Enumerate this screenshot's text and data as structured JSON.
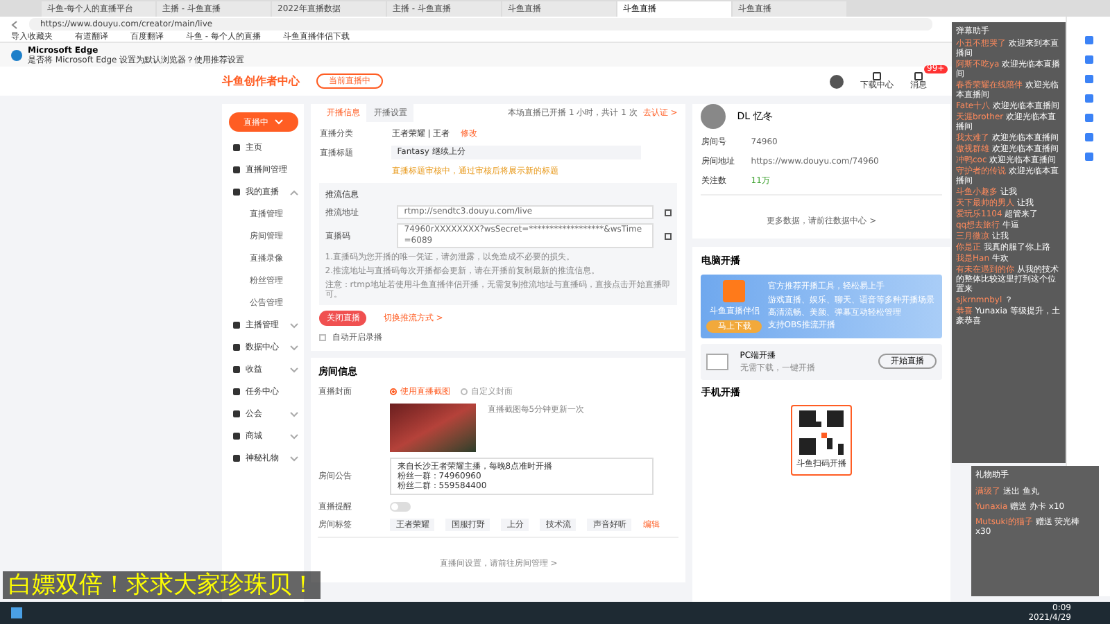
{
  "browser": {
    "tabs": [
      {
        "label": "斗鱼-每个人的直播平台",
        "selected": false
      },
      {
        "label": "主播 - 斗鱼直播",
        "selected": false
      },
      {
        "label": "2022年直播数据",
        "selected": false
      },
      {
        "label": "主播 - 斗鱼直播",
        "selected": false
      },
      {
        "label": "斗鱼直播",
        "selected": false
      },
      {
        "label": "斗鱼直播",
        "selected": true
      },
      {
        "label": "斗鱼直播",
        "selected": false
      }
    ],
    "url": "https://www.douyu.com/creator/main/live",
    "bookmarks": [
      "导入收藏夹",
      "有道翻译",
      "百度翻译",
      "斗鱼 - 每个人的直播",
      "斗鱼直播伴侣下载"
    ],
    "notification": {
      "title": "Microsoft Edge",
      "text": "是否将 Microsoft Edge 设置为默认浏览器？使用推荐设置"
    }
  },
  "site_header": {
    "logo": "斗鱼创作者中心",
    "badge": "当前直播中",
    "nav": [
      {
        "label": "下载中心"
      },
      {
        "label": "消息"
      }
    ],
    "message_count": "99+"
  },
  "sidebar": {
    "live_button": "直播中",
    "items": [
      {
        "label": "主页"
      },
      {
        "label": "直播间管理"
      },
      {
        "label": "我的直播",
        "expanded": true,
        "children": [
          {
            "label": "直播管理"
          },
          {
            "label": "房间管理"
          },
          {
            "label": "直播录像"
          },
          {
            "label": "粉丝管理"
          },
          {
            "label": "公告管理"
          }
        ]
      },
      {
        "label": "主播管理",
        "expanded": false
      },
      {
        "label": "数据中心",
        "expanded": false
      },
      {
        "label": "收益",
        "expanded": false
      },
      {
        "label": "任务中心"
      },
      {
        "label": "公会",
        "expanded": false
      },
      {
        "label": "商城",
        "expanded": false
      },
      {
        "label": "神秘礼物",
        "expanded": false
      }
    ]
  },
  "live_info": {
    "tabs": [
      {
        "label": "开播信息",
        "selected": true
      },
      {
        "label": "开播设置",
        "selected": false
      }
    ],
    "notice": "本场直播已开播 1 小时，共计 1 次",
    "notice_link": "去认证 >",
    "category": {
      "label": "直播分类",
      "value": "王者荣耀 | 王者",
      "action": "修改"
    },
    "title": {
      "label": "直播标题",
      "value": "Fantasy 继续上分"
    },
    "warning": "直播标题审核中，通过审核后将展示新的标题",
    "stream": {
      "heading": "推流信息",
      "fields": [
        {
          "label": "推流地址",
          "value": "rtmp://sendtc3.douyu.com/live"
        },
        {
          "label": "直播码",
          "value": "74960rXXXXXXXX?wsSecret=******************&wsTime=6089"
        }
      ],
      "notes": [
        "1.直播码为您开播的唯一凭证，请勿泄露，以免造成不必要的损失。",
        "2.推流地址与直播码每次开播都会更新，请在开播前复制最新的推流信息。",
        "注意：rtmp地址若使用斗鱼直播伴侣开播，无需复制推流地址与直播码，直接点击开始直播即可。"
      ]
    },
    "stop_button": "关闭直播",
    "switch_link": "切换推流方式 >",
    "auto_record": {
      "label": "自动开启录播",
      "checked": false
    }
  },
  "room_info": {
    "heading": "房间信息",
    "cover": {
      "label": "直播封面",
      "options": [
        {
          "label": "使用直播截图",
          "selected": true
        },
        {
          "label": "自定义封面",
          "selected": false
        }
      ],
      "hint": "直播截图每5分钟更新一次"
    },
    "announcement": {
      "label": "房间公告",
      "lines": [
        "来自长沙王者荣耀主播，每晚8点准时开播",
        "粉丝一群：74960960",
        "粉丝二群：559584400"
      ]
    },
    "toggle": {
      "label": "直播提醒",
      "on": false
    },
    "tags": {
      "label": "房间标签",
      "items": [
        "王者荣耀",
        "国服打野",
        "上分",
        "技术流",
        "声音好听"
      ],
      "edit": "编辑"
    },
    "footer_link": "直播间设置，请前往房间管理 >"
  },
  "profile": {
    "name": "DL 忆冬",
    "rows": [
      {
        "label": "房间号",
        "value": "74960"
      },
      {
        "label": "房间地址",
        "value": "https://www.douyu.com/74960"
      },
      {
        "label": "关注数",
        "value": "11万"
      }
    ],
    "footer_link": "更多数据，请前往数据中心 >"
  },
  "pc_live": {
    "heading": "电脑开播",
    "banner": {
      "title": "官方推荐开播工具，轻松易上手",
      "lines": [
        "游戏直播、娱乐、聊天、语音等多种开播场景",
        "高清流畅、美颜、弹幕互动轻松管理",
        "支持OBS推流开播"
      ],
      "app_name": "斗鱼直播伴侣",
      "download": "马上下载"
    },
    "pc": {
      "title": "PC端开播",
      "subtitle": "无需下载，一键开播",
      "button": "开始直播"
    }
  },
  "mobile": {
    "heading": "手机开播",
    "qr_caption": "斗鱼扫码开播"
  },
  "chat": {
    "title": "弹幕助手",
    "messages": [
      {
        "user": "小丑不想哭了",
        "text": "欢迎来到本直播间"
      },
      {
        "user": "阿斯不吃ya",
        "text": "欢迎光临本直播间"
      },
      {
        "user": "春香荣耀在线陪伴",
        "text": "欢迎光临本直播间"
      },
      {
        "user": "Fate十八",
        "text": "欢迎光临本直播间"
      },
      {
        "user": "天涯brother",
        "text": "欢迎光临本直播间"
      },
      {
        "user": "我太难了",
        "text": "欢迎光临本直播间"
      },
      {
        "user": "傲视群雄",
        "text": "欢迎光临本直播间"
      },
      {
        "user": "冲鸭coc",
        "text": "欢迎光临本直播间"
      },
      {
        "user": "守护者的传说",
        "text": "欢迎光临本直播间"
      },
      {
        "user": "斗鱼小趣多",
        "text": "让我"
      },
      {
        "user": "天下最帅的男人",
        "text": "让我"
      },
      {
        "user": "爱玩乐1104",
        "text": "超管来了"
      },
      {
        "user": "qq想去旅行",
        "text": "牛逼"
      },
      {
        "user": "三月微凉",
        "text": "让我"
      },
      {
        "user": "你是正",
        "text": "我真的服了你上路"
      },
      {
        "user": "我是Han",
        "text": "牛欢"
      },
      {
        "user": "有未在遇到的你",
        "text": "从我的技术的整体比较这里打到这个位置来"
      },
      {
        "user": "sjkrnmnbyl",
        "text": "？"
      },
      {
        "user": "恭喜",
        "text": "Yunaxia 等级提升，土豪恭喜"
      }
    ]
  },
  "gift_panel": {
    "title": "礼物助手",
    "entries": [
      {
        "user": "满级了",
        "text": "送出 鱼丸"
      },
      {
        "user": "Yunaxia",
        "text": "赠送 办卡 x10"
      },
      {
        "user": "Mutsuki的猫子",
        "text": "赠送 荧光棒 x30"
      }
    ]
  },
  "subtitle": "白嫖双倍！求求大家珍珠贝！",
  "taskbar": {
    "time": "0:09",
    "date": "2021/4/29"
  }
}
